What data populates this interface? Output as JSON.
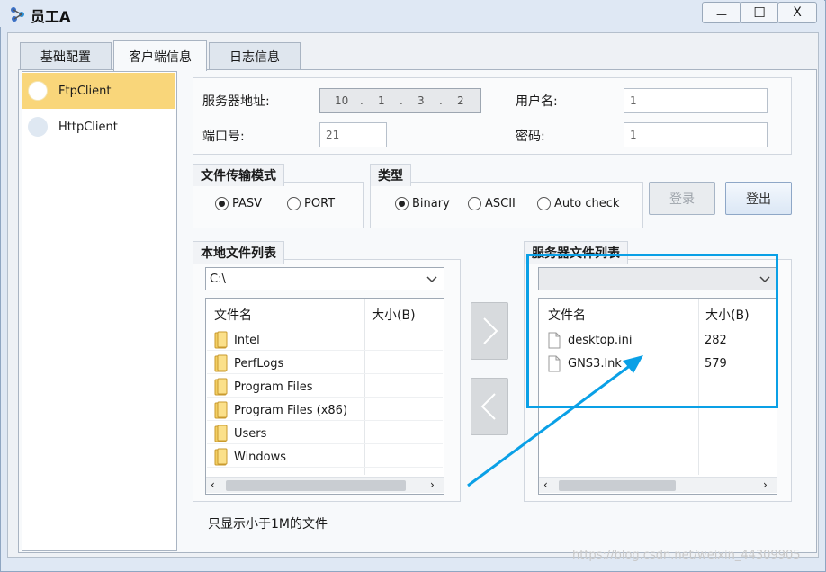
{
  "window": {
    "title": "员工A",
    "min_glyph": "—",
    "max_glyph": "☐",
    "close_glyph": "X"
  },
  "tabs": [
    {
      "label": "基础配置",
      "active": false
    },
    {
      "label": "客户端信息",
      "active": true
    },
    {
      "label": "日志信息",
      "active": false
    }
  ],
  "client_list": [
    {
      "label": "FtpClient",
      "selected": true
    },
    {
      "label": "HttpClient",
      "selected": false
    }
  ],
  "server": {
    "address_label": "服务器地址:",
    "ip": [
      "10",
      "1",
      "3",
      "2"
    ],
    "port_label": "端口号:",
    "port_value": "21",
    "username_label": "用户名:",
    "username_value": "1",
    "password_label": "密码:",
    "password_value": "1"
  },
  "transfer_mode": {
    "title": "文件传输模式",
    "options": [
      {
        "label": "PASV",
        "checked": true
      },
      {
        "label": "PORT",
        "checked": false
      }
    ]
  },
  "type": {
    "title": "类型",
    "options": [
      {
        "label": "Binary",
        "checked": true
      },
      {
        "label": "ASCII",
        "checked": false
      },
      {
        "label": "Auto check",
        "checked": false
      }
    ]
  },
  "buttons": {
    "login": "登录",
    "logout": "登出"
  },
  "local": {
    "title": "本地文件列表",
    "path": "C:\\",
    "col_name": "文件名",
    "col_size": "大小(B)",
    "files": [
      "Intel",
      "PerfLogs",
      "Program Files",
      "Program Files (x86)",
      "Users",
      "Windows"
    ]
  },
  "remote": {
    "title": "服务器文件列表",
    "path": "",
    "col_name": "文件名",
    "col_size": "大小(B)",
    "files": [
      {
        "name": "desktop.ini",
        "size": "282"
      },
      {
        "name": "GNS3.lnk",
        "size": "579"
      }
    ]
  },
  "footer_note": "只显示小于1M的文件",
  "watermark": "https://blog.csdn.net/weixin_44309905",
  "colors": {
    "accent_highlight": "#0aa0e6",
    "selected_item": "#f9d67a"
  }
}
